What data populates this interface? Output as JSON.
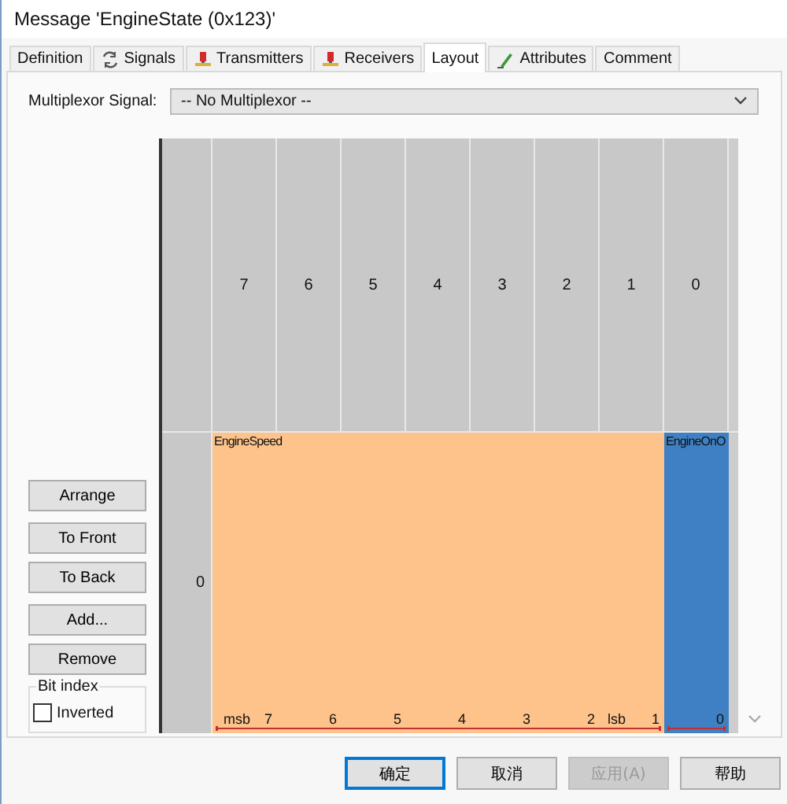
{
  "window": {
    "title": "Message 'EngineState (0x123)'"
  },
  "tabs": [
    {
      "label": "Definition",
      "kind": "plain",
      "selected": false
    },
    {
      "label": "Signals",
      "kind": "signals",
      "selected": false
    },
    {
      "label": "Transmitters",
      "kind": "ecu",
      "selected": false
    },
    {
      "label": "Receivers",
      "kind": "ecu",
      "selected": false
    },
    {
      "label": "Layout",
      "kind": "plain",
      "selected": true
    },
    {
      "label": "Attributes",
      "kind": "pencil",
      "selected": false
    },
    {
      "label": "Comment",
      "kind": "plain",
      "selected": false
    }
  ],
  "multiplexor": {
    "label": "Multiplexor Signal:",
    "value": "-- No Multiplexor --"
  },
  "side_buttons": [
    [
      "Arrange"
    ],
    [
      "To Front",
      "To Back"
    ],
    [
      "Add...",
      "Remove"
    ]
  ],
  "bit_index": {
    "title": "Bit index",
    "inverted": {
      "label": "Inverted",
      "checked": false
    }
  },
  "layout": {
    "column_headers": [
      "7",
      "6",
      "5",
      "4",
      "3",
      "2",
      "1",
      "0"
    ],
    "rows": [
      {
        "label": "0",
        "signals": [
          {
            "name": "EngineSpeed",
            "color": "#fdc38a",
            "bits": [
              "7",
              "6",
              "5",
              "4",
              "3",
              "2",
              "1"
            ],
            "msb": "msb",
            "lsb": "lsb"
          },
          {
            "name": "EngineOnO",
            "color": "#3f80c4",
            "bits": [
              "0"
            ]
          }
        ]
      }
    ]
  },
  "buttons": [
    {
      "label": "确定",
      "default": true,
      "disabled": false
    },
    {
      "label": "取消",
      "default": false,
      "disabled": false
    },
    {
      "label": "应用(A)",
      "default": false,
      "disabled": true
    },
    {
      "label": "帮助",
      "default": false,
      "disabled": false
    }
  ]
}
